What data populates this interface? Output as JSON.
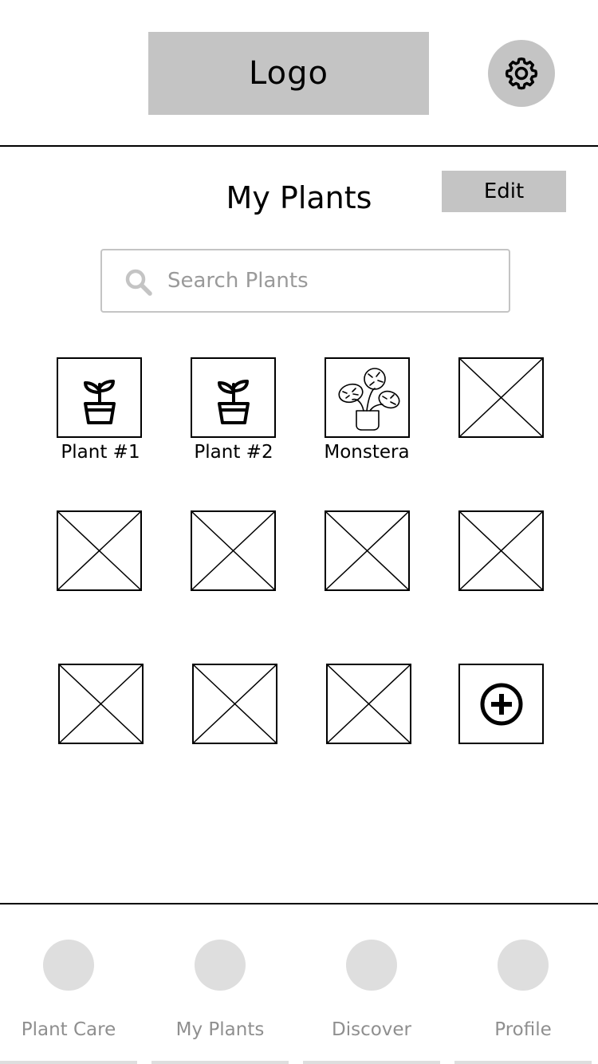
{
  "header": {
    "logo_label": "Logo",
    "settings_icon": "gear-icon"
  },
  "page": {
    "title": "My Plants",
    "edit_label": "Edit"
  },
  "search": {
    "placeholder": "Search Plants",
    "value": "",
    "icon": "search-icon"
  },
  "grid": {
    "tiles": [
      {
        "label": "Plant #1",
        "icon": "plant-pot-icon"
      },
      {
        "label": "Plant #2",
        "icon": "plant-pot-icon"
      },
      {
        "label": "Monstera",
        "icon": "monstera-icon"
      },
      {
        "label": "",
        "icon": "image-placeholder-icon"
      },
      {
        "label": "",
        "icon": "image-placeholder-icon"
      },
      {
        "label": "",
        "icon": "image-placeholder-icon"
      },
      {
        "label": "",
        "icon": "image-placeholder-icon"
      },
      {
        "label": "",
        "icon": "image-placeholder-icon"
      },
      {
        "label": "",
        "icon": "image-placeholder-icon"
      },
      {
        "label": "",
        "icon": "image-placeholder-icon"
      },
      {
        "label": "",
        "icon": "image-placeholder-icon"
      },
      {
        "label": "",
        "icon": "add-circle-icon"
      }
    ]
  },
  "bottom_nav": {
    "items": [
      {
        "label": "Plant Care"
      },
      {
        "label": "My Plants"
      },
      {
        "label": "Discover"
      },
      {
        "label": "Profile"
      }
    ]
  },
  "colors": {
    "placeholder_gray": "#c4c4c4",
    "nav_gray": "#dedede",
    "nav_text": "#8f8f8f"
  }
}
